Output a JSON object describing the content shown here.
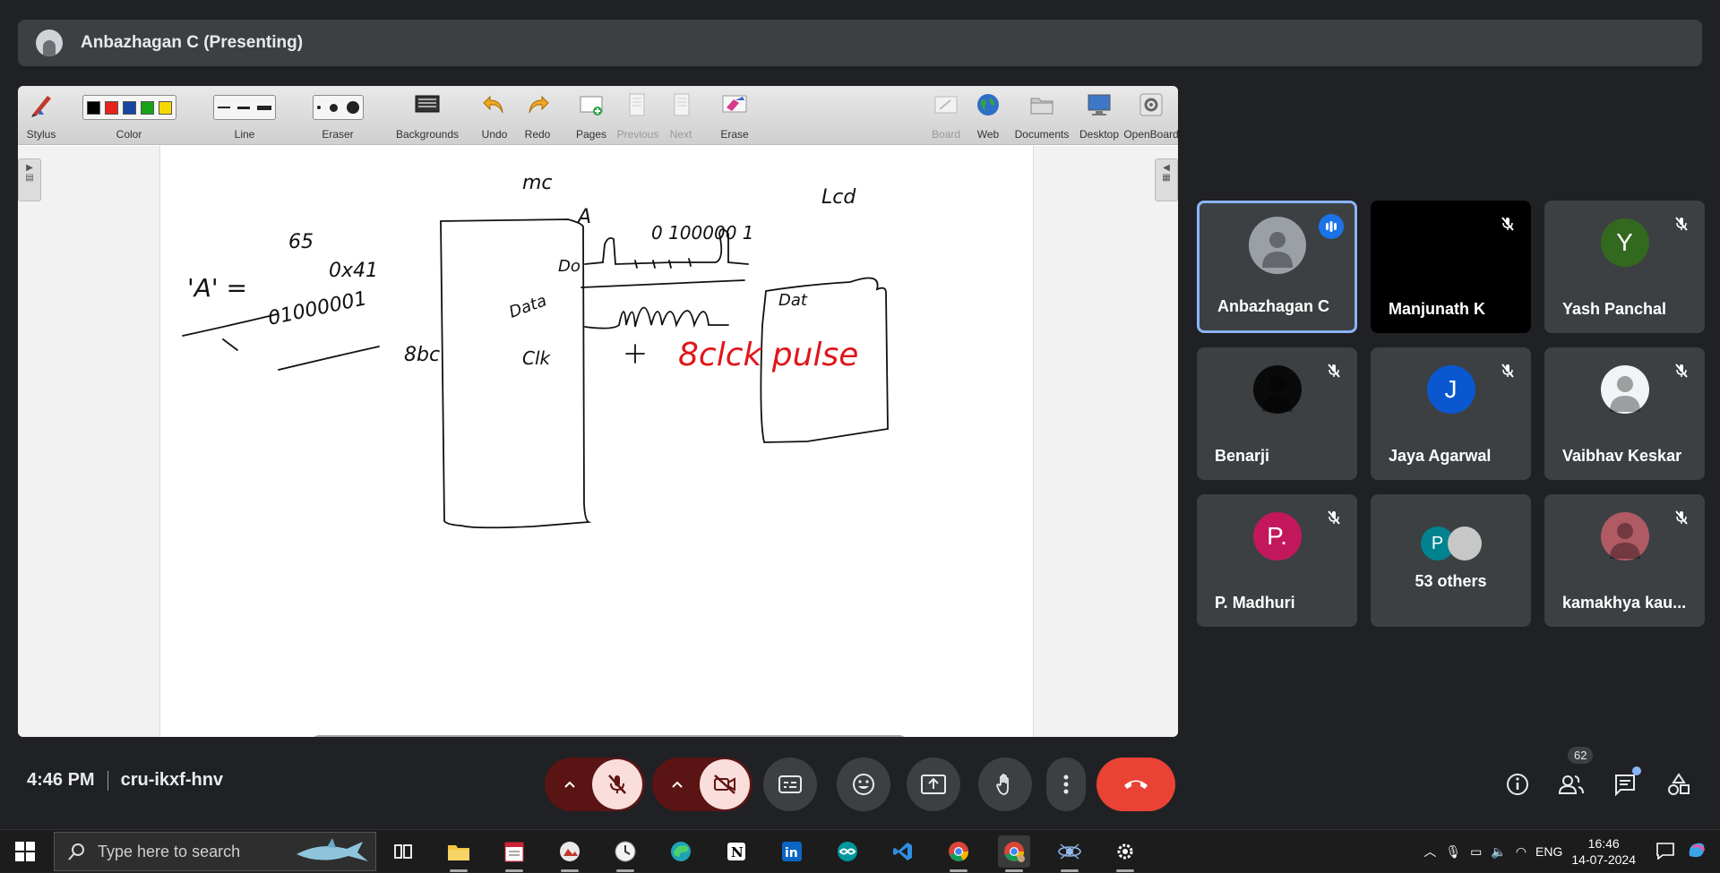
{
  "header": {
    "presenter": "Anbazhagan C (Presenting)"
  },
  "whiteboard": {
    "toolbar": [
      {
        "label": "Stylus",
        "icon": "stylus-icon",
        "enabled": true
      },
      {
        "label": "Color",
        "icon": "color-swatches",
        "enabled": true
      },
      {
        "label": "Line",
        "icon": "line-width-icon",
        "enabled": true
      },
      {
        "label": "Eraser",
        "icon": "eraser-size-icon",
        "enabled": true
      },
      {
        "label": "Backgrounds",
        "icon": "backgrounds-icon",
        "enabled": true
      },
      {
        "label": "Undo",
        "icon": "undo-icon",
        "enabled": true
      },
      {
        "label": "Redo",
        "icon": "redo-icon",
        "enabled": true
      },
      {
        "label": "Pages",
        "icon": "pages-icon",
        "enabled": true
      },
      {
        "label": "Previous",
        "icon": "previous-page-icon",
        "enabled": false
      },
      {
        "label": "Next",
        "icon": "next-page-icon",
        "enabled": false
      },
      {
        "label": "Erase",
        "icon": "erase-icon",
        "enabled": true
      },
      {
        "label": "Board",
        "icon": "board-icon",
        "enabled": false
      },
      {
        "label": "Web",
        "icon": "globe-icon",
        "enabled": true
      },
      {
        "label": "Documents",
        "icon": "folder-icon",
        "enabled": true
      },
      {
        "label": "Desktop",
        "icon": "desktop-icon",
        "enabled": true
      },
      {
        "label": "OpenBoard",
        "icon": "gear-icon",
        "enabled": true
      }
    ],
    "colors": [
      "#000000",
      "#e8221a",
      "#1746a2",
      "#16a31a",
      "#f5d800"
    ],
    "pen_color_annotation": "#e0161b",
    "handwriting": {
      "mc": "mc",
      "lcd": "Lcd",
      "a_label": "A",
      "a_eq": "'A' =",
      "hex_65": "65",
      "hex_0x41": "0x41",
      "binary": "01000001",
      "bits_8": "8bc",
      "wave_label_a": "A",
      "wave_bits": "0 100000 1",
      "do": "Do",
      "data_left": "Data",
      "clk_left": "Clk",
      "data_right": "Dat",
      "plus": "+",
      "red_note": "8clck pulse"
    },
    "floating_tools": [
      "pen-icon",
      "eraser-icon",
      "highlighter-icon",
      "pointer-icon",
      "laser-pointer-icon",
      "hand-icon",
      "zoom-in-icon",
      "zoom-out-icon",
      "magic-pen-icon",
      "line-icon",
      "text-icon",
      "capture-icon",
      "keyboard-icon"
    ]
  },
  "participants": [
    {
      "name": "Anbazhagan C",
      "avatar_type": "photo",
      "initial": "",
      "color": "#9aa0a6",
      "speaking": true,
      "muted": false
    },
    {
      "name": "Manjunath K",
      "avatar_type": "none",
      "initial": "",
      "color": "#000000",
      "speaking": false,
      "muted": true
    },
    {
      "name": "Yash Panchal",
      "avatar_type": "letter",
      "initial": "Y",
      "color": "#33691e",
      "speaking": false,
      "muted": true
    },
    {
      "name": "Benarji",
      "avatar_type": "photo",
      "initial": "",
      "color": "#0a0a0a",
      "speaking": false,
      "muted": true
    },
    {
      "name": "Jaya Agarwal",
      "avatar_type": "letter",
      "initial": "J",
      "color": "#0b57d0",
      "speaking": false,
      "muted": true
    },
    {
      "name": "Vaibhav Keskar",
      "avatar_type": "photo",
      "initial": "",
      "color": "#f1f3f4",
      "speaking": false,
      "muted": true
    },
    {
      "name": "P. Madhuri",
      "avatar_type": "letter",
      "initial": "P.",
      "color": "#c2185b",
      "speaking": false,
      "muted": true
    },
    {
      "name": "53 others",
      "avatar_type": "group",
      "initial": "P",
      "color": "#00838f",
      "speaking": false,
      "muted": false
    },
    {
      "name": "kamakhya kau...",
      "avatar_type": "photo",
      "initial": "",
      "color": "#b05a63",
      "speaking": false,
      "muted": true
    }
  ],
  "meeting": {
    "time": "4:46 PM",
    "code": "cru-ikxf-hnv",
    "people_count": "62",
    "mic_muted": true,
    "camera_off": true
  },
  "taskbar": {
    "search_placeholder": "Type here to search",
    "apps": [
      "file-explorer-icon",
      "notepad-icon",
      "photos-icon",
      "clock-app-icon",
      "edge-icon",
      "notion-icon",
      "linkedin-icon",
      "arduino-icon",
      "vscode-icon",
      "chrome-icon",
      "chrome-profile-icon",
      "satellite-app-icon",
      "settings-icon"
    ],
    "language": "ENG",
    "clock_time": "16:46",
    "clock_date": "14-07-2024"
  }
}
